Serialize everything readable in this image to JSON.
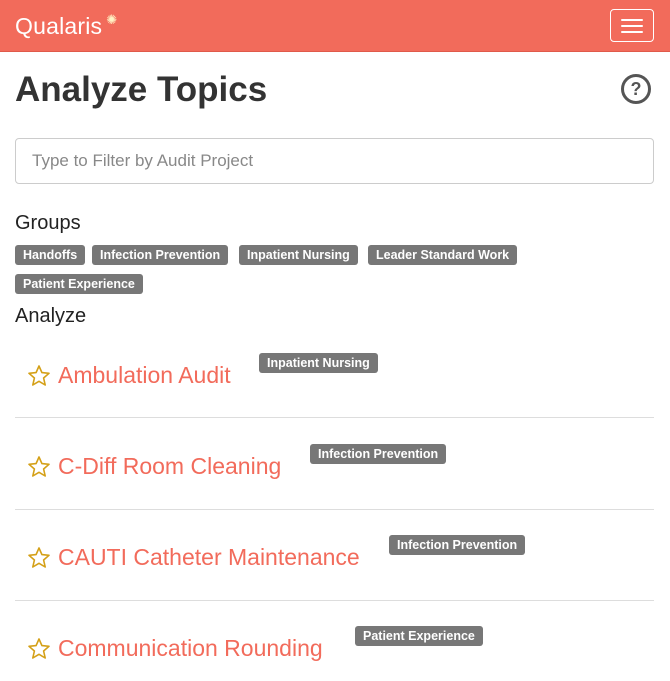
{
  "navbar": {
    "brand": "Qualaris",
    "brand_mark": "✺",
    "menu_icon": "hamburger-icon"
  },
  "page": {
    "title": "Analyze Topics",
    "help_icon": "?"
  },
  "filter": {
    "placeholder": "Type to Filter by Audit Project",
    "value": ""
  },
  "groups": {
    "label": "Groups",
    "items": [
      "Handoffs",
      "Infection Prevention",
      "Inpatient Nursing",
      "Leader Standard Work",
      "Patient Experience"
    ]
  },
  "analyze": {
    "label": "Analyze",
    "topics": [
      {
        "name": "Ambulation Audit",
        "tag": "Inpatient Nursing"
      },
      {
        "name": "C-Diff Room Cleaning",
        "tag": "Infection Prevention"
      },
      {
        "name": "CAUTI Catheter Maintenance",
        "tag": "Infection Prevention"
      },
      {
        "name": "Communication Rounding",
        "tag": "Patient Experience"
      }
    ]
  },
  "colors": {
    "brand": "#f26b5b",
    "label": "#777777",
    "star": "#d4a017"
  }
}
